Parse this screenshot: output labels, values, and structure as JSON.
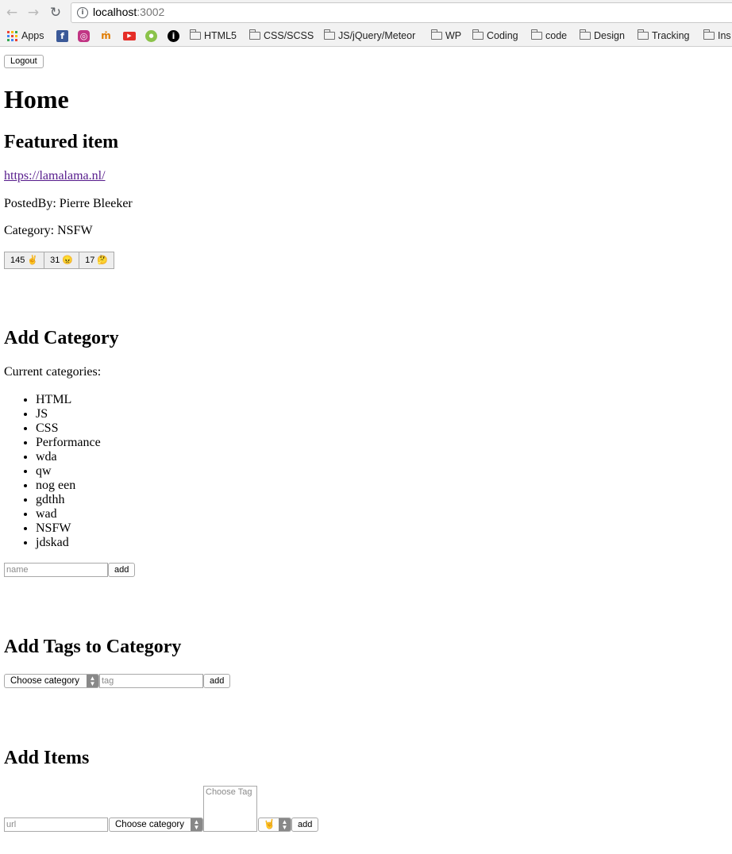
{
  "browser": {
    "url_host": "localhost",
    "url_port": ":3002",
    "bookmarks": [
      {
        "label": "Apps",
        "icon": "apps-grid-icon"
      },
      {
        "label": "",
        "icon": "facebook-icon"
      },
      {
        "label": "",
        "icon": "instagram-icon"
      },
      {
        "label": "",
        "icon": "mn-icon"
      },
      {
        "label": "",
        "icon": "youtube-icon"
      },
      {
        "label": "",
        "icon": "green-circle-icon"
      },
      {
        "label": "",
        "icon": "info-black-icon"
      },
      {
        "label": "HTML5",
        "icon": "folder-icon"
      },
      {
        "label": "CSS/SCSS",
        "icon": "folder-icon"
      },
      {
        "label": "JS/jQuery/Meteor",
        "icon": "folder-icon"
      },
      {
        "label": "WP",
        "icon": "folder-icon"
      },
      {
        "label": "Coding",
        "icon": "folder-icon"
      },
      {
        "label": "code",
        "icon": "folder-icon"
      },
      {
        "label": "Design",
        "icon": "folder-icon"
      },
      {
        "label": "Tracking",
        "icon": "folder-icon"
      },
      {
        "label": "Ins",
        "icon": "folder-icon"
      }
    ]
  },
  "page": {
    "logout_label": "Logout",
    "title": "Home",
    "featured": {
      "heading": "Featured item",
      "link": "https://lamalama.nl/",
      "posted_by": "PostedBy: Pierre Bleeker",
      "category": "Category: NSFW",
      "reactions": [
        {
          "label": "145 ✌️"
        },
        {
          "label": "31 😠"
        },
        {
          "label": "17 🤔"
        }
      ]
    },
    "add_category": {
      "heading": "Add Category",
      "current_label": "Current categories:",
      "categories": [
        "HTML",
        "JS",
        "CSS",
        "Performance",
        "wda",
        "qw",
        "nog een",
        "gdthh",
        "wad",
        "NSFW",
        "jdskad"
      ],
      "name_placeholder": "name",
      "add_label": "add"
    },
    "add_tags": {
      "heading": "Add Tags to Category",
      "category_select": "Choose category",
      "tag_placeholder": "tag",
      "add_label": "add"
    },
    "add_items": {
      "heading": "Add Items",
      "url_placeholder": "url",
      "category_select": "Choose category",
      "tag_listbox_placeholder": "Choose Tag",
      "emoji_select": "🤘",
      "add_label": "add"
    }
  }
}
